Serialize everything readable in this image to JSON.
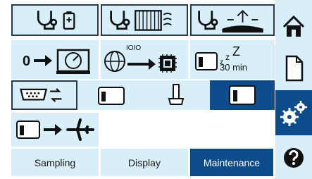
{
  "tabs": [
    {
      "label": "Sampling"
    },
    {
      "label": "Display"
    },
    {
      "label": "Maintenance"
    }
  ],
  "active_tab": "Maintenance",
  "tiles": [
    {
      "icon": "stethoscope-battery-icon"
    },
    {
      "icon": "stethoscope-filter-icon"
    },
    {
      "icon": "stethoscope-surface-icon"
    },
    {
      "icon": "zero-gauge-icon"
    },
    {
      "icon": "globe-chip-icon",
      "text": "IOIO"
    },
    {
      "icon": "device-sleep-icon",
      "text": "30 min"
    },
    {
      "icon": "serial-transfer-icon"
    },
    {
      "icon": "sampler-device-icon"
    },
    {
      "icon": "probe-device-icon"
    },
    {
      "icon": "sampler-device-selected-icon"
    },
    {
      "icon": "device-flight-icon"
    }
  ],
  "sidebar": [
    {
      "icon": "home-icon"
    },
    {
      "icon": "document-icon"
    },
    {
      "icon": "settings-gears-icon"
    },
    {
      "icon": "help-icon"
    }
  ],
  "colors": {
    "tile": "#d8eef8",
    "accent": "#0e4b8a",
    "border": "#2a3a4a"
  }
}
